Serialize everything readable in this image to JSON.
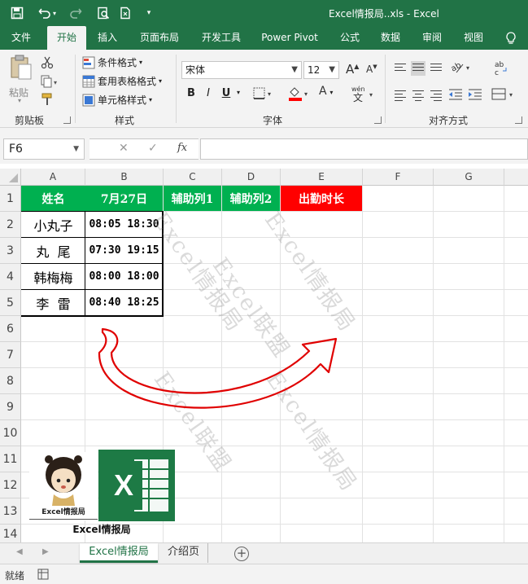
{
  "titlebar": {
    "title": "Excel情报局..xls  -  Excel"
  },
  "tabs": [
    "文件",
    "开始",
    "插入",
    "页面布局",
    "开发工具",
    "Power Pivot",
    "公式",
    "数据",
    "审阅",
    "视图"
  ],
  "ribbon": {
    "clipboard": {
      "paste_label": "粘贴",
      "group_label": "剪贴板"
    },
    "styles": {
      "conditional_format": "条件格式",
      "table_format": "套用表格格式",
      "cell_style": "单元格样式",
      "group_label": "样式"
    },
    "font": {
      "font_name": "宋体",
      "font_size": "12",
      "group_label": "字体",
      "bold": "B",
      "italic": "I",
      "underline": "U",
      "grow": "A",
      "shrink": "A",
      "color_a": "A",
      "wen": "wén\n文"
    },
    "alignment": {
      "group_label": "对齐方式",
      "wrap": "ab\nc"
    }
  },
  "formula_bar": {
    "name_box": "F6",
    "cancel": "✕",
    "enter": "✓",
    "fx": "fx",
    "value": ""
  },
  "grid": {
    "columns": [
      "A",
      "B",
      "C",
      "D",
      "E",
      "F",
      "G"
    ],
    "rows": [
      "1",
      "2",
      "3",
      "4",
      "5",
      "6",
      "7",
      "8",
      "9",
      "10",
      "11",
      "12",
      "13",
      "14"
    ],
    "header_row": {
      "name": "姓名",
      "date": "7月27日",
      "aux1": "辅助列1",
      "aux2": "辅助列2",
      "duration": "出勤时长"
    },
    "records": [
      {
        "name": "小丸子",
        "times": "08:05 18:30"
      },
      {
        "name": "丸  尾",
        "times": "07:30 19:15"
      },
      {
        "name": "韩梅梅",
        "times": "08:00 18:00"
      },
      {
        "name": "李  雷",
        "times": "08:40 18:25"
      }
    ]
  },
  "watermarks": [
    "Excel情报局",
    "Excel联盟",
    "Excel情报局",
    "Excel联盟",
    "Excel情报局"
  ],
  "logo": {
    "caption": "Excel情报局",
    "mini_caption": "Excel情报局",
    "excel_letter": "X"
  },
  "sheets": {
    "active": "Excel情报局",
    "other": "介绍页",
    "add": "+"
  },
  "status": {
    "text": "就绪"
  },
  "colors": {
    "excel_green": "#217346",
    "header_green": "#00b050",
    "header_red": "#ff0000",
    "arrow_red": "#e00000"
  }
}
